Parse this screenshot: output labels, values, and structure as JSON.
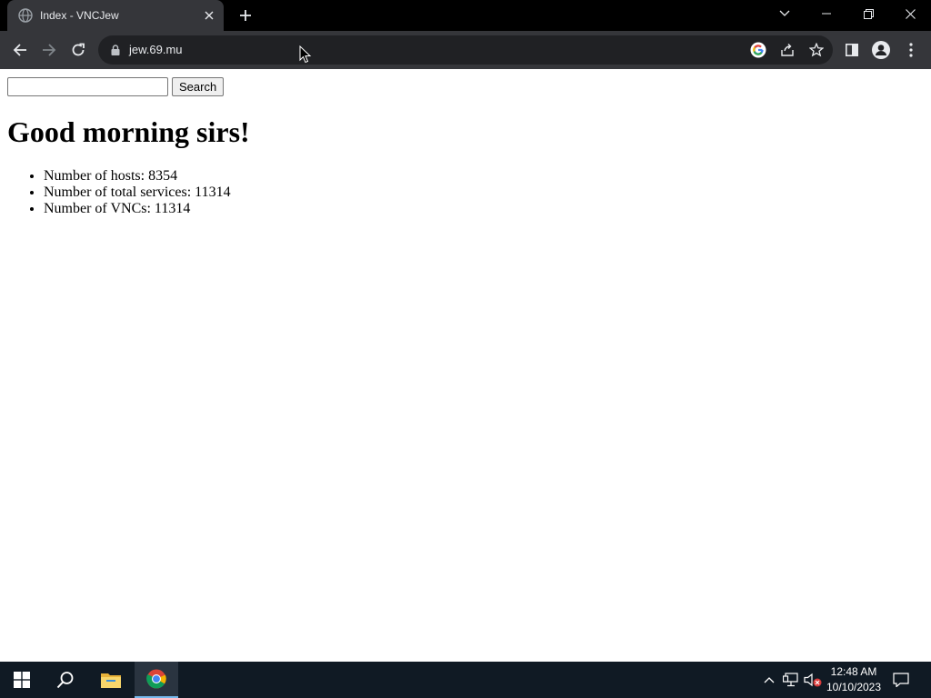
{
  "browser": {
    "tab": {
      "title": "Index - VNCJew",
      "favicon": "globe-icon"
    },
    "url": "jew.69.mu",
    "window_controls": [
      "chevron-down-icon",
      "minimize-icon",
      "restore-icon",
      "close-icon"
    ],
    "toolbar_icons": [
      "back-icon",
      "forward-icon",
      "reload-icon",
      "lock-icon",
      "google-icon",
      "share-icon",
      "star-icon",
      "side-panel-icon",
      "profile-icon",
      "menu-icon"
    ]
  },
  "page": {
    "search": {
      "value": "",
      "button_label": "Search"
    },
    "heading": "Good morning sirs!",
    "stats": [
      "Number of hosts: 8354",
      "Number of total services: 11314",
      "Number of VNCs: 11314"
    ]
  },
  "taskbar": {
    "apps": [
      "windows-start-icon",
      "search-icon",
      "file-explorer-icon",
      "chrome-icon"
    ],
    "tray_icons": [
      "chevron-up-icon",
      "network-icon",
      "volume-muted-icon",
      "notification-icon"
    ],
    "time": "12:48 AM",
    "date": "10/10/2023"
  },
  "colors": {
    "tabstrip": "#000000",
    "toolbar": "#35363a",
    "omnibox": "#202124",
    "taskbar": "#101a24",
    "taskbar_active_underline": "#76b9ed"
  }
}
